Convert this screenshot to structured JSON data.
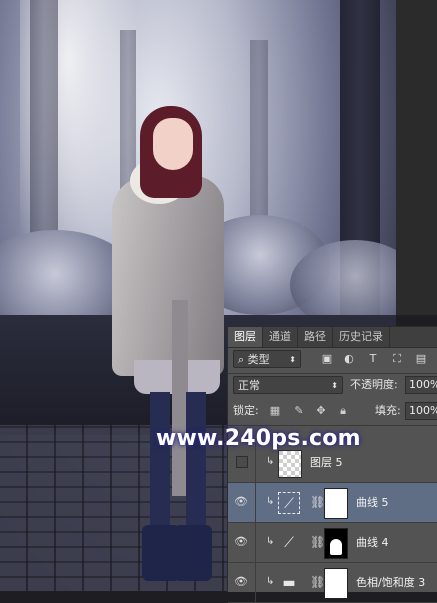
{
  "watermark": {
    "text": "www.240ps.com"
  },
  "layers_panel": {
    "tabs": [
      {
        "label": "图层",
        "active": true
      },
      {
        "label": "通道",
        "active": false
      },
      {
        "label": "路径",
        "active": false
      },
      {
        "label": "历史记录",
        "active": false
      }
    ],
    "filter": {
      "selected": "类型",
      "icons": [
        "image-filter-icon",
        "adjustment-filter-icon",
        "type-filter-icon",
        "shape-filter-icon",
        "smart-object-filter-icon"
      ]
    },
    "blend_mode": {
      "selected": "正常"
    },
    "opacity": {
      "label": "不透明度:",
      "value": "100%"
    },
    "lock": {
      "label": "锁定:",
      "icons": [
        "lock-transparent-icon",
        "lock-image-icon",
        "lock-position-icon",
        "lock-all-icon"
      ]
    },
    "fill": {
      "label": "填充:",
      "value": "100%"
    },
    "layers": [
      {
        "name": "图层 5",
        "visible": false,
        "clipped": true,
        "kind": "pixel",
        "selected": false
      },
      {
        "name": "曲线 5",
        "visible": true,
        "clipped": true,
        "kind": "curves",
        "mask": "white",
        "selected": true
      },
      {
        "name": "曲线 4",
        "visible": true,
        "clipped": true,
        "kind": "curves",
        "mask": "black-with-white-shape",
        "selected": false
      },
      {
        "name": "色相/饱和度 3",
        "visible": true,
        "clipped": true,
        "kind": "hue-saturation",
        "mask": "white",
        "selected": false
      }
    ]
  }
}
